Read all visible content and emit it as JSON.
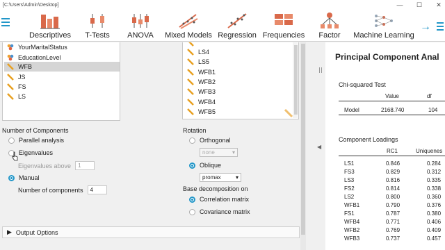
{
  "titlebar": {
    "path": "[C:\\Users\\Admin\\Desktop]",
    "controls": [
      "—",
      "☐",
      "✕"
    ]
  },
  "toolbar": {
    "buttons": [
      {
        "label": "Descriptives",
        "icon": "descriptives-icon"
      },
      {
        "label": "T-Tests",
        "icon": "t-tests-icon"
      },
      {
        "label": "ANOVA",
        "icon": "anova-icon"
      },
      {
        "label": "Mixed Models",
        "icon": "mixed-models-icon"
      },
      {
        "label": "Regression",
        "icon": "regression-icon"
      },
      {
        "label": "Frequencies",
        "icon": "frequencies-icon"
      },
      {
        "label": "Factor",
        "icon": "factor-icon"
      },
      {
        "label": "Machine Learning",
        "icon": "machine-learning-icon"
      }
    ]
  },
  "variables": {
    "available": [
      {
        "name": "YourMaritalStatus",
        "type": "nominal",
        "selected": false
      },
      {
        "name": "EducationLevel",
        "type": "nominal",
        "selected": false
      },
      {
        "name": "WFB",
        "type": "scale",
        "selected": true
      },
      {
        "name": "JS",
        "type": "scale",
        "selected": false
      },
      {
        "name": "FS",
        "type": "scale",
        "selected": false
      },
      {
        "name": "LS",
        "type": "scale",
        "selected": false
      }
    ],
    "target": [
      "LS4",
      "LS5",
      "WFB1",
      "WFB2",
      "WFB3",
      "WFB4",
      "WFB5"
    ]
  },
  "components": {
    "title": "Number of Components",
    "parallel": "Parallel analysis",
    "eigenvalues": "Eigenvalues",
    "eigen_above_label": "Eigenvalues above",
    "eigen_above_value": "1",
    "manual": "Manual",
    "num_label": "Number of components",
    "num_value": "4"
  },
  "rotation": {
    "title": "Rotation",
    "orthogonal": "Orthogonal",
    "orthogonal_select": "none",
    "oblique": "Oblique",
    "oblique_select": "promax"
  },
  "base": {
    "title": "Base decomposition on",
    "correlation": "Correlation matrix",
    "covariance": "Covariance matrix"
  },
  "output_options": "Output Options",
  "results": {
    "title": "Principal Component Anal",
    "chi_title": "Chi-squared Test",
    "chi_headers": [
      "Value",
      "df"
    ],
    "chi_row": {
      "label": "Model",
      "value": "2168.740",
      "df": "104"
    },
    "loadings_title": "Component Loadings",
    "loadings_headers": [
      "RC1",
      "Uniquenes"
    ],
    "loadings": [
      {
        "item": "LS1",
        "rc1": "0.846",
        "u": "0.284"
      },
      {
        "item": "FS3",
        "rc1": "0.829",
        "u": "0.312"
      },
      {
        "item": "LS3",
        "rc1": "0.816",
        "u": "0.335"
      },
      {
        "item": "FS2",
        "rc1": "0.814",
        "u": "0.338"
      },
      {
        "item": "LS2",
        "rc1": "0.800",
        "u": "0.360"
      },
      {
        "item": "WFB1",
        "rc1": "0.790",
        "u": "0.376"
      },
      {
        "item": "FS1",
        "rc1": "0.787",
        "u": "0.380"
      },
      {
        "item": "WFB4",
        "rc1": "0.771",
        "u": "0.406"
      },
      {
        "item": "WFB2",
        "rc1": "0.769",
        "u": "0.409"
      },
      {
        "item": "WFB3",
        "rc1": "0.737",
        "u": "0.457"
      }
    ]
  },
  "colors": {
    "accent": "#2196c8",
    "nominal": "#f0a030",
    "scale": "#e8a020",
    "toolbar_icon": "#d9694a"
  }
}
